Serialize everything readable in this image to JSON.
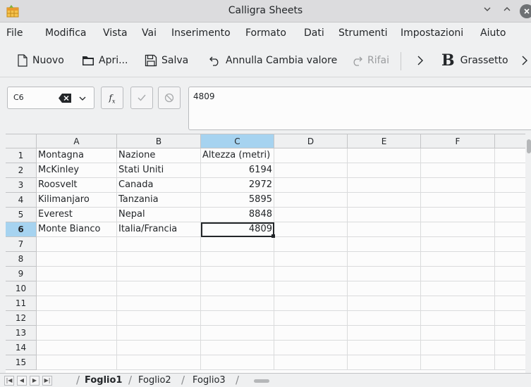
{
  "window": {
    "title": "Calligra Sheets"
  },
  "menu": [
    "File",
    "Modifica",
    "Vista",
    "Vai",
    "Inserimento",
    "Formato",
    "Dati",
    "Strumenti",
    "Impostazioni",
    "Aiuto"
  ],
  "toolbar": {
    "new_label": "Nuovo",
    "open_label": "Apri...",
    "save_label": "Salva",
    "undo_label": "Annulla Cambia valore",
    "redo_label": "Rifai",
    "bold_glyph": "B",
    "bold_label": "Grassetto"
  },
  "formula": {
    "cell_ref": "C6",
    "fx_label": "fx",
    "content": "4809"
  },
  "grid": {
    "columns": [
      "A",
      "B",
      "C",
      "D",
      "E",
      "F"
    ],
    "active_column": "C",
    "active_row": 6,
    "rows": [
      {
        "n": "1",
        "a": "Montagna",
        "b": "Nazione",
        "c": "Altezza (metri)"
      },
      {
        "n": "2",
        "a": "McKinley",
        "b": "Stati Uniti",
        "c": "6194"
      },
      {
        "n": "3",
        "a": "Roosvelt",
        "b": "Canada",
        "c": "2972"
      },
      {
        "n": "4",
        "a": "Kilimanjaro",
        "b": "Tanzania",
        "c": "5895"
      },
      {
        "n": "5",
        "a": "Everest",
        "b": "Nepal",
        "c": "8848"
      },
      {
        "n": "6",
        "a": "Monte Bianco",
        "b": "Italia/Francia",
        "c": "4809"
      },
      {
        "n": "7",
        "a": "",
        "b": "",
        "c": ""
      },
      {
        "n": "8",
        "a": "",
        "b": "",
        "c": ""
      },
      {
        "n": "9",
        "a": "",
        "b": "",
        "c": ""
      },
      {
        "n": "10",
        "a": "",
        "b": "",
        "c": ""
      },
      {
        "n": "11",
        "a": "",
        "b": "",
        "c": ""
      },
      {
        "n": "12",
        "a": "",
        "b": "",
        "c": ""
      },
      {
        "n": "13",
        "a": "",
        "b": "",
        "c": ""
      },
      {
        "n": "14",
        "a": "",
        "b": "",
        "c": ""
      },
      {
        "n": "15",
        "a": "",
        "b": "",
        "c": ""
      }
    ]
  },
  "sheets": [
    "Foglio1",
    "Foglio2",
    "Foglio3"
  ],
  "active_sheet": "Foglio1",
  "colors": {
    "selection_header": "#a6d3f0",
    "background": "#eff0f1"
  }
}
